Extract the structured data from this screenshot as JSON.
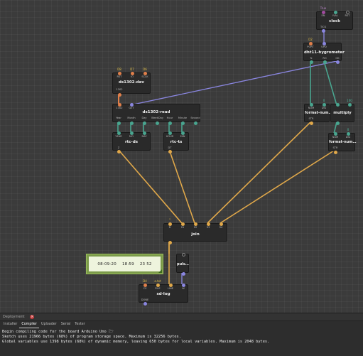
{
  "nodes": {
    "clock": {
      "title": "clock",
      "top_labels": [
        "True",
        "",
        ""
      ],
      "pins_in": [
        "EN",
        "IVAL",
        "RST"
      ],
      "pins_out": [
        "TICK"
      ]
    },
    "dht11": {
      "title": "dht11-hygrometer",
      "top_labels": [
        "D2",
        ""
      ],
      "pins_in": [
        "PORT",
        "UPD"
      ],
      "pins_out": [
        "Tc",
        "RH",
        "OK"
      ]
    },
    "ds1302_dev": {
      "title": "ds1302-dev",
      "top_labels": [
        "D8",
        "D7",
        "D6"
      ],
      "pins_in": [
        "RST",
        "IO",
        "SCLK"
      ],
      "pins_out": [
        "1302"
      ]
    },
    "ds1302_read": {
      "title": "ds1302-read",
      "pins_in": [
        "1302",
        "GET"
      ],
      "pins_out": [
        "Year",
        "Month",
        "Day",
        "WeekDay",
        "Hour",
        "Minute",
        "Second"
      ]
    },
    "format_num1": {
      "title": "format-num…",
      "top_labels": [
        "",
        "0"
      ],
      "pins_in": [
        "NUM",
        "DIG"
      ],
      "pins_out": [
        "STR"
      ]
    },
    "multiply": {
      "title": "multiply",
      "top_labels": [
        "",
        "100"
      ]
    },
    "format_num2": {
      "title": "format-num…",
      "top_labels": [
        "",
        "0"
      ],
      "pins_in": [
        "NUM",
        "DIG"
      ],
      "pins_out": [
        "STR"
      ]
    },
    "rtc_ds": {
      "title": "rtc-ds",
      "pins_in": [
        "YEAR",
        "MO",
        "DAY"
      ],
      "pins_out": [
        "Z"
      ]
    },
    "rtc_ts": {
      "title": "rtc-ts",
      "pins_in": [
        "HOUR",
        "MIN"
      ],
      "pins_out": [
        "DT"
      ]
    },
    "join": {
      "title": "join",
      "top_labels": [
        "\"",
        "",
        "",
        "",
        "",
        ""
      ],
      "pins_in": [
        "D",
        "S1",
        "S2",
        "S3",
        "S4"
      ]
    },
    "puls": {
      "title": "puls…"
    },
    "sd_log": {
      "title": "sd-log",
      "top_labels": [
        "D4",
        "a.txt",
        "",
        ""
      ],
      "pins_in": [
        "CS",
        "FILE",
        "LINE",
        "W"
      ],
      "pins_out": [
        "DONE"
      ]
    }
  },
  "watch": {
    "date": "08-09-20",
    "time": "18:59",
    "temp": "23",
    "hum": "52"
  },
  "panel": {
    "title": "Deployment",
    "close_icon": "close-icon",
    "tabs": [
      "Installer",
      "Compiler",
      "Uploader",
      "Serial",
      "Tester"
    ],
    "active_tab": "Compiler",
    "console_lines": [
      "Begin compiling code for the board Arduino Uno 🗁",
      "",
      "",
      "Sketch uses 21966 bytes (68%) of program storage space. Maximum is 32256 bytes.",
      "Global variables use 1398 bytes (68%) of dynamic memory, leaving 650 bytes for local variables. Maximum is 2048 bytes."
    ]
  },
  "colors": {
    "string_pin": "#e0a84a",
    "number_pin": "#49a58f",
    "pulse_pin": "#8a86e0",
    "port_pin": "#e07f4a",
    "canvas_bg": "#3b3b3b",
    "node_bg": "#2a2a2a"
  }
}
